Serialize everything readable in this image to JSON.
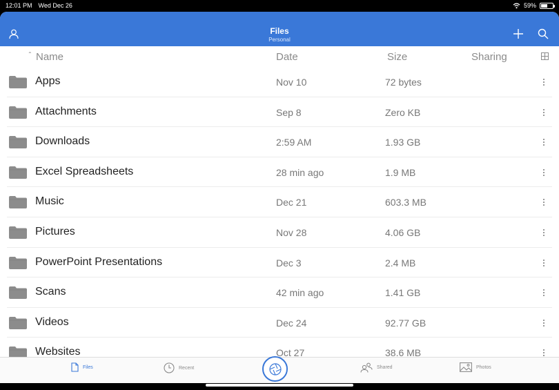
{
  "status": {
    "time": "12:01 PM",
    "date": "Wed Dec 26",
    "battery": "59%",
    "battery_level": 0.59
  },
  "header": {
    "title": "Files",
    "subtitle": "Personal"
  },
  "columns": {
    "name": "Name",
    "date": "Date",
    "size": "Size",
    "sharing": "Sharing"
  },
  "folders": [
    {
      "name": "Apps",
      "date": "Nov 10",
      "size": "72 bytes"
    },
    {
      "name": "Attachments",
      "date": "Sep 8",
      "size": "Zero KB"
    },
    {
      "name": "Downloads",
      "date": "2:59 AM",
      "size": "1.93 GB"
    },
    {
      "name": "Excel Spreadsheets",
      "date": "28 min ago",
      "size": "1.9 MB"
    },
    {
      "name": "Music",
      "date": "Dec 21",
      "size": "603.3 MB"
    },
    {
      "name": "Pictures",
      "date": "Nov 28",
      "size": "4.06 GB"
    },
    {
      "name": "PowerPoint Presentations",
      "date": "Dec 3",
      "size": "2.4 MB"
    },
    {
      "name": "Scans",
      "date": "42 min ago",
      "size": "1.41 GB"
    },
    {
      "name": "Videos",
      "date": "Dec 24",
      "size": "92.77 GB"
    },
    {
      "name": "Websites",
      "date": "Oct 27",
      "size": "38.6 MB"
    }
  ],
  "tabs": {
    "files": "Files",
    "recent": "Recent",
    "shared": "Shared",
    "photos": "Photos"
  },
  "colors": {
    "accent": "#3a78d8",
    "folder": "#8c8c8c"
  }
}
